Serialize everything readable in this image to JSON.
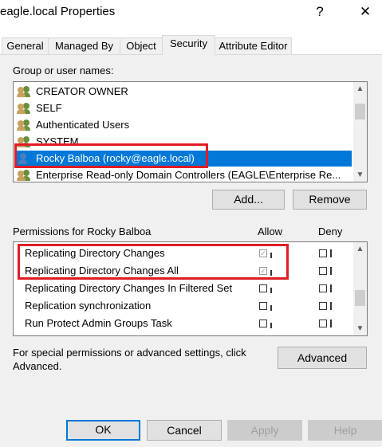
{
  "window": {
    "title": "eagle.local Properties",
    "help_glyph": "?",
    "close_glyph": "✕"
  },
  "tabs": [
    {
      "label": "General"
    },
    {
      "label": "Managed By"
    },
    {
      "label": "Object"
    },
    {
      "label": "Security",
      "active": true
    },
    {
      "label": "Attribute Editor"
    }
  ],
  "security": {
    "group_label": "Group or user names:",
    "users": [
      {
        "name": "CREATOR OWNER",
        "icon": "group-icon"
      },
      {
        "name": "SELF",
        "icon": "group-icon"
      },
      {
        "name": "Authenticated Users",
        "icon": "group-icon"
      },
      {
        "name": "SYSTEM",
        "icon": "group-icon"
      },
      {
        "name": "Rocky Balboa (rocky@eagle.local)",
        "icon": "user-icon",
        "selected": true
      },
      {
        "name": "Enterprise Read-only Domain Controllers (EAGLE\\Enterprise Re...",
        "icon": "group-icon"
      }
    ],
    "add_label": "Add...",
    "remove_label": "Remove",
    "permissions_label": "Permissions for Rocky Balboa",
    "allow_label": "Allow",
    "deny_label": "Deny",
    "permissions": [
      {
        "name": "Replicating Directory Changes",
        "allow": true,
        "deny": false
      },
      {
        "name": "Replicating Directory Changes All",
        "allow": true,
        "deny": false
      },
      {
        "name": "Replicating Directory Changes In Filtered Set",
        "allow": false,
        "deny": false
      },
      {
        "name": "Replication synchronization",
        "allow": false,
        "deny": false
      },
      {
        "name": "Run Protect Admin Groups Task",
        "allow": false,
        "deny": false
      }
    ],
    "special_text_line1": "For special permissions or advanced settings, click",
    "special_text_line2": "Advanced.",
    "advanced_label": "Advanced"
  },
  "footer": {
    "ok_label": "OK",
    "cancel_label": "Cancel",
    "apply_label": "Apply",
    "help_label": "Help"
  },
  "colors": {
    "selection": "#0078d7",
    "highlight_box": "#e01c24",
    "group_icon_green": "#6a8f3a",
    "group_icon_tan": "#c8a060",
    "user_icon_blue": "#4a7fc0"
  },
  "icons": {
    "scroll_up": "▲",
    "scroll_down": "▼",
    "check": "✓"
  }
}
